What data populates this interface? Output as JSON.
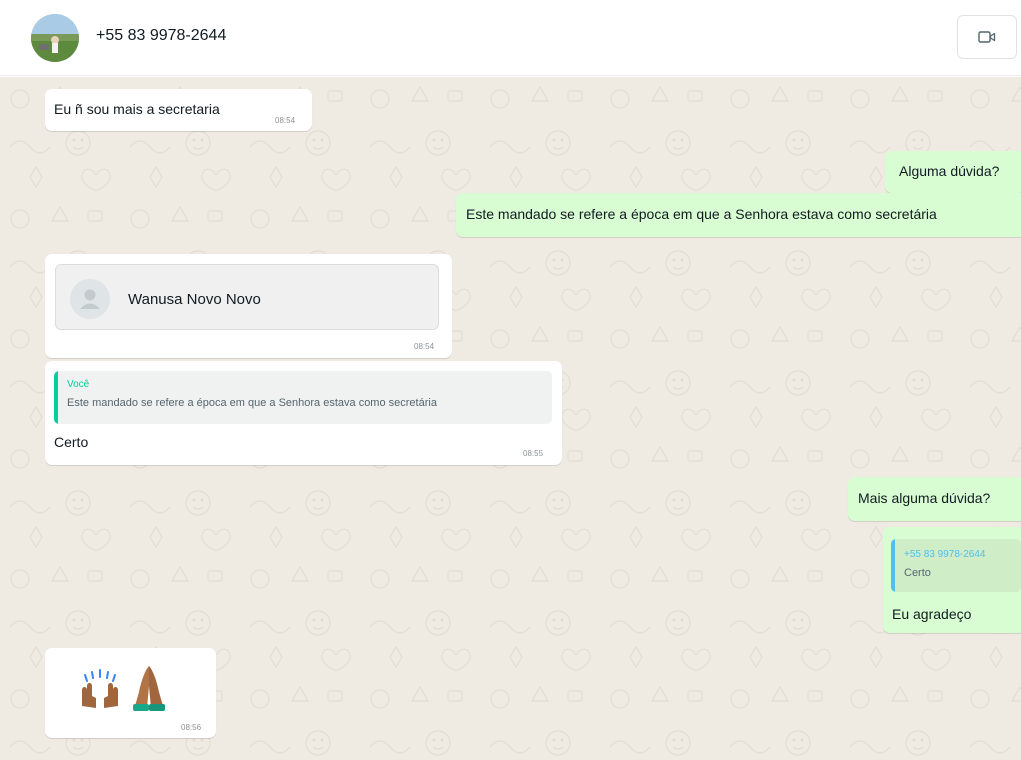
{
  "header": {
    "contact_name": "+55 83 9978-2644",
    "video_icon": "video-call-icon"
  },
  "colors": {
    "chat_background": "#efeae2",
    "incoming_bubble": "#ffffff",
    "outgoing_bubble": "#d9fdd3",
    "quote_you": "#06cf9c",
    "quote_contact": "#53bdeb"
  },
  "messages": [
    {
      "direction": "incoming",
      "text": "Eu ñ sou mais a secretaria",
      "time": "08:54"
    },
    {
      "direction": "outgoing",
      "text": "Alguma dúvida?"
    },
    {
      "direction": "outgoing",
      "text": "Este mandado se refere a época em que a Senhora estava como secretária"
    },
    {
      "direction": "incoming",
      "type": "contact",
      "contact_name": "Wanusa Novo Novo",
      "time": "08:54"
    },
    {
      "direction": "incoming",
      "quote_author": "Você",
      "quote_text": "Este mandado se refere a época em que a Senhora estava como secretária",
      "text": "Certo",
      "time": "08:55"
    },
    {
      "direction": "outgoing",
      "text": "Mais alguma dúvida?"
    },
    {
      "direction": "outgoing",
      "quote_author": "+55 83 9978-2644",
      "quote_text": "Certo",
      "text": "Eu agradeço"
    },
    {
      "direction": "incoming",
      "type": "emoji",
      "emoji": [
        "raising-hands-emoji",
        "folded-hands-emoji"
      ],
      "time": "08:56"
    }
  ]
}
